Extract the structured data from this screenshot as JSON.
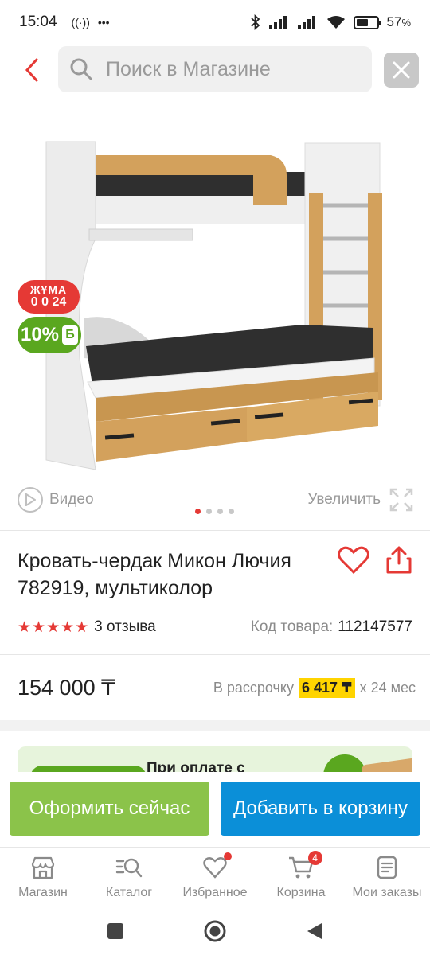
{
  "status_bar": {
    "time": "15:04",
    "battery": "57",
    "battery_unit": "%",
    "battery_level": 0.57
  },
  "search": {
    "placeholder": "Поиск в Магазине"
  },
  "gallery": {
    "badge_friday": {
      "line1": "ЖҰМА",
      "line2": "0 0 24"
    },
    "badge_discount": {
      "value": "10%",
      "suffix": "Б"
    },
    "video_label": "Видео",
    "zoom_label": "Увеличить",
    "slides": 4,
    "active_slide": 1
  },
  "product": {
    "title": "Кровать-чердак Микон Лючия 782919, мультиколор",
    "rating": 5,
    "reviews": "3 отзыва",
    "code_label": "Код товара:",
    "code": "112147577",
    "price": "154 000 ₸",
    "installment_label": "В рассрочку",
    "installment_amount": "6 417 ₸",
    "installment_term": "х 24 мес"
  },
  "promo": {
    "text": "При оплате с"
  },
  "actions": {
    "buy_now": "Оформить сейчас",
    "add_to_cart": "Добавить в корзину"
  },
  "tabbar": {
    "items": [
      {
        "label": "Магазин",
        "icon": "shop-icon"
      },
      {
        "label": "Каталог",
        "icon": "catalog-search-icon"
      },
      {
        "label": "Избранное",
        "icon": "heart-icon"
      },
      {
        "label": "Корзина",
        "icon": "cart-icon",
        "badge": "4"
      },
      {
        "label": "Мои заказы",
        "icon": "orders-icon"
      }
    ]
  },
  "colors": {
    "accent_red": "#e53935",
    "green": "#8bc34a",
    "blue": "#0b8fd8",
    "yellow": "#ffd400"
  }
}
